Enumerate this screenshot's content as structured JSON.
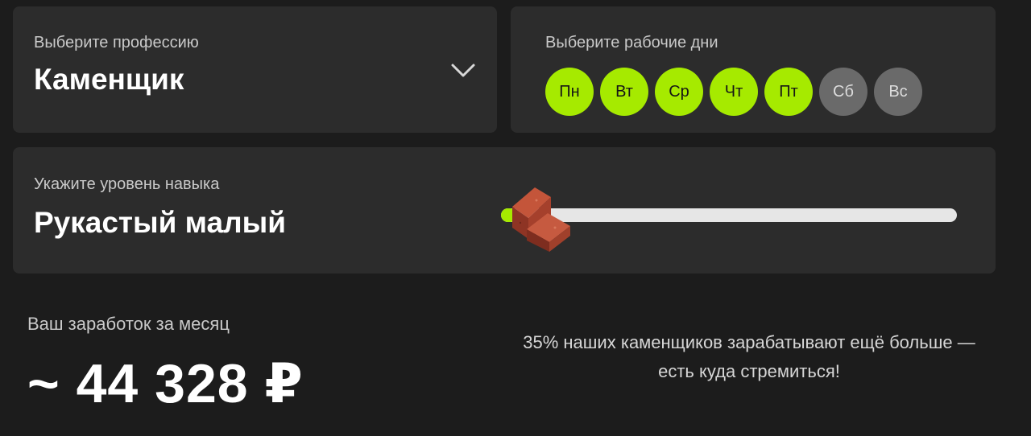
{
  "profession": {
    "label": "Выберите профессию",
    "value": "Каменщик",
    "dropdown_icon": "chevron-down-icon"
  },
  "workdays": {
    "label": "Выберите рабочие дни",
    "days": [
      {
        "label": "Пн",
        "selected": true
      },
      {
        "label": "Вт",
        "selected": true
      },
      {
        "label": "Ср",
        "selected": true
      },
      {
        "label": "Чт",
        "selected": true
      },
      {
        "label": "Пт",
        "selected": true
      },
      {
        "label": "Сб",
        "selected": false
      },
      {
        "label": "Вс",
        "selected": false
      }
    ]
  },
  "skill": {
    "label": "Укажите уровень навыка",
    "value": "Рукастый малый",
    "slider_level": 0.02,
    "thumb_icon": "brick-icon"
  },
  "earnings": {
    "label": "Ваш заработок за месяц",
    "value": "~ 44 328 ₽",
    "note": "35% наших каменщиков зарабатывают ещё больше — есть куда стремиться!"
  },
  "colors": {
    "background": "#1c1c1c",
    "card": "#2c2c2c",
    "accent": "#a6ea00",
    "inactive_day": "#6a6a6a",
    "track": "#e6e6e6"
  }
}
